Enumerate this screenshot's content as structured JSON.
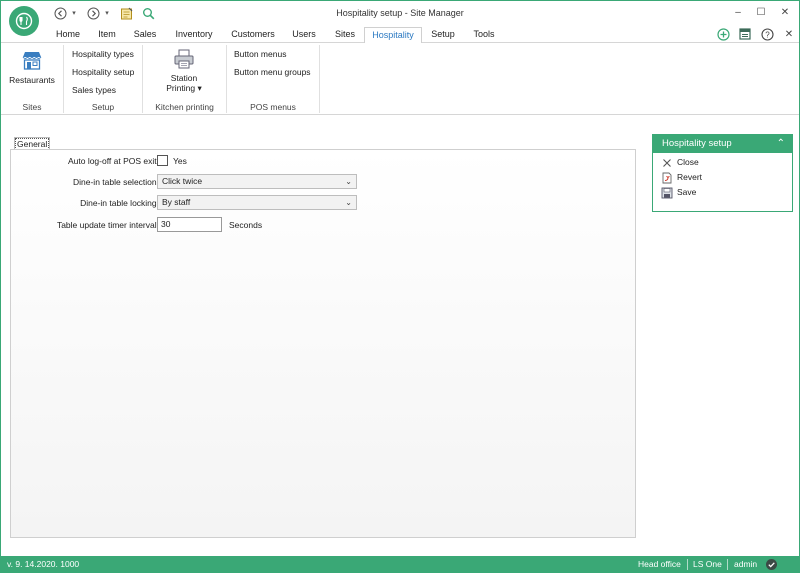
{
  "window": {
    "title": "Hospitality setup - Site Manager",
    "accent_color": "#3aa876",
    "controls": {
      "minimize": "–",
      "maximize": "☐",
      "close": "✕"
    }
  },
  "quick_access": [
    "back-icon",
    "dropdown-icon",
    "forward-icon",
    "dropdown-icon",
    "notes-icon",
    "search-icon"
  ],
  "menu": {
    "tabs": [
      "Home",
      "Item",
      "Sales",
      "Inventory",
      "Customers",
      "Users",
      "Sites",
      "Hospitality",
      "Setup",
      "Tools"
    ],
    "active": "Hospitality"
  },
  "right_icons": [
    "add-icon",
    "panel-icon",
    "help-icon",
    "close-icon"
  ],
  "ribbon": {
    "sites": {
      "group_label": "Sites",
      "restaurants": "Restaurants"
    },
    "setup": {
      "group_label": "Setup",
      "items": [
        "Hospitality types",
        "Hospitality setup",
        "Sales types"
      ]
    },
    "kitchen": {
      "group_label": "Kitchen printing",
      "station_line1": "Station",
      "station_line2": "Printing",
      "station_arrow": "▾"
    },
    "pos": {
      "group_label": "POS menus",
      "items": [
        "Button menus",
        "Button menu groups"
      ]
    }
  },
  "form": {
    "tab": "General",
    "auto_logoff": {
      "label": "Auto log-off at POS exit:",
      "checkbox_label": "Yes",
      "checked": false
    },
    "table_selection": {
      "label": "Dine-in table selection:",
      "value": "Click twice"
    },
    "table_locking": {
      "label": "Dine-in table locking:",
      "value": "By staff"
    },
    "timer_interval": {
      "label": "Table update timer interval:",
      "value": "30",
      "unit": "Seconds"
    }
  },
  "side_panel": {
    "title": "Hospitality setup",
    "close": "Close",
    "revert": "Revert",
    "save": "Save"
  },
  "status": {
    "version": "v. 9. 14.2020. 1000",
    "location": "Head office",
    "product": "LS One",
    "user": "admin"
  }
}
